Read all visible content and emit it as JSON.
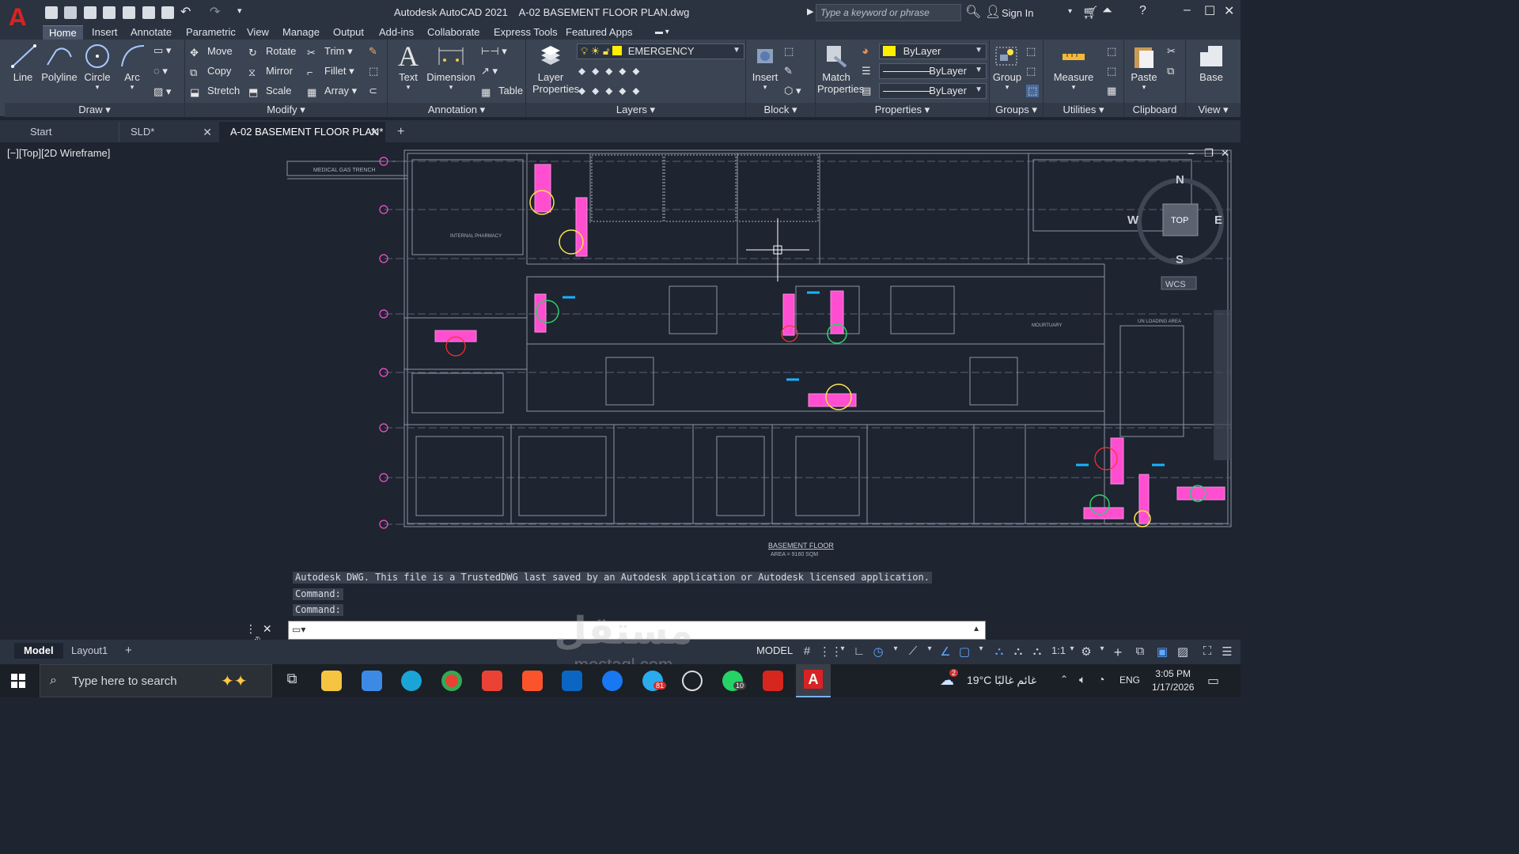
{
  "app": {
    "logo_letter": "A",
    "title": "Autodesk AutoCAD 2021",
    "document": "A-02 BASEMENT FLOOR PLAN.dwg",
    "search_placeholder": "Type a keyword or phrase",
    "sign_in": "Sign In"
  },
  "ribbon_tabs": [
    "Home",
    "Insert",
    "Annotate",
    "Parametric",
    "View",
    "Manage",
    "Output",
    "Add-ins",
    "Collaborate",
    "Express Tools",
    "Featured Apps"
  ],
  "ribbon": {
    "draw": {
      "title": "Draw",
      "line": "Line",
      "polyline": "Polyline",
      "circle": "Circle",
      "arc": "Arc"
    },
    "modify": {
      "title": "Modify",
      "move": "Move",
      "rotate": "Rotate",
      "trim": "Trim",
      "copy": "Copy",
      "mirror": "Mirror",
      "fillet": "Fillet",
      "stretch": "Stretch",
      "scale": "Scale",
      "array": "Array"
    },
    "annotation": {
      "title": "Annotation",
      "text": "Text",
      "dimension": "Dimension",
      "table": "Table"
    },
    "layers": {
      "title": "Layers",
      "layer_properties_1": "Layer",
      "layer_properties_2": "Properties",
      "current_layer": "EMERGENCY"
    },
    "block": {
      "title": "Block",
      "insert": "Insert"
    },
    "properties": {
      "title": "Properties",
      "match_1": "Match",
      "match_2": "Properties",
      "color": "ByLayer",
      "linetype": "ByLayer",
      "lineweight": "ByLayer"
    },
    "groups": {
      "title": "Groups",
      "group": "Group"
    },
    "utilities": {
      "title": "Utilities",
      "measure": "Measure"
    },
    "clipboard": {
      "title": "Clipboard",
      "paste": "Paste"
    },
    "view": {
      "title": "View",
      "base": "Base"
    }
  },
  "doc_tabs": [
    "Start",
    "SLD*",
    "A-02 BASEMENT FLOOR PLAN*"
  ],
  "viewport": {
    "label": "[−][Top][2D Wireframe]",
    "viewcube": {
      "n": "N",
      "s": "S",
      "w": "W",
      "e": "E",
      "top": "TOP",
      "wcs": "WCS"
    },
    "labels": {
      "trench": "MEDICAL GAS TRENCH",
      "pharmacy": "INTERNAL PHARMACY",
      "mortuary": "MOURTUARY",
      "loading": "UN LOADING AREA",
      "floor_title": "BASEMENT FLOOR",
      "floor_area": "AREA = 9160 SQM"
    }
  },
  "command": {
    "history": [
      "Autodesk DWG.  This file is a TrustedDWG last saved by an Autodesk application or Autodesk licensed application.",
      "Command:",
      "Command:"
    ]
  },
  "layout_tabs": [
    "Model",
    "Layout1"
  ],
  "status": {
    "model": "MODEL",
    "scale": "1:1"
  },
  "taskbar": {
    "search": "Type here to search",
    "weather": "19°C  غائم غالبًا",
    "lang": "ENG",
    "time": "3:05 PM",
    "date": "1/17/2026",
    "badge_weather": "2",
    "badge_telegram": "81",
    "badge_whatsapp": "10"
  },
  "watermark": {
    "arabic": "مستقل",
    "latin": "mostaql.com"
  },
  "colors": {
    "accent_red": "#d72323",
    "layer_yellow": "#ffee00",
    "magenta": "#ff4fd0",
    "cyan": "#18b4ff",
    "plan_lines": "#8c95a3"
  }
}
